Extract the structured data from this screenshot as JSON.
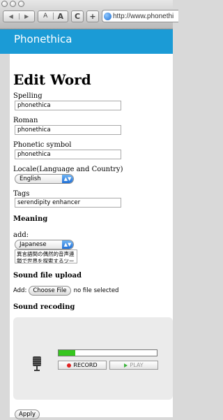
{
  "browser": {
    "url": "http://www.phonethi",
    "back_label": "◀",
    "forward_label": "▶",
    "font_small": "A",
    "font_large": "A",
    "reload_label": "C",
    "add_label": "+"
  },
  "app": {
    "title": "Phonethica"
  },
  "page": {
    "heading": "Edit Word",
    "fields": {
      "spelling": {
        "label": "Spelling",
        "value": "phonethica"
      },
      "roman": {
        "label": "Roman",
        "value": "phonethica"
      },
      "phonetic": {
        "label": "Phonetic symbol",
        "value": "phonethica"
      },
      "locale": {
        "label": "Locale(Language and Country)",
        "value": "English"
      },
      "tags": {
        "label": "Tags",
        "value": "serendipity enhancer"
      }
    },
    "meaning": {
      "heading": "Meaning",
      "add_label": "add:",
      "language": "Japanese",
      "text": "異言語間の偶然的音声連鎖で世界を探索するツール"
    },
    "upload": {
      "heading": "Sound file upload",
      "add_label": "Add:",
      "button_label": "Choose File",
      "status": "no file selected"
    },
    "recording": {
      "heading": "Sound recoding",
      "level": 0.17,
      "record_label": "RECORD",
      "play_label": "PLAY"
    },
    "apply_label": "Apply"
  },
  "colors": {
    "brand": "#1b9bd6",
    "record": "#e02020",
    "play": "#3cb43c",
    "level": "#36c61f"
  }
}
